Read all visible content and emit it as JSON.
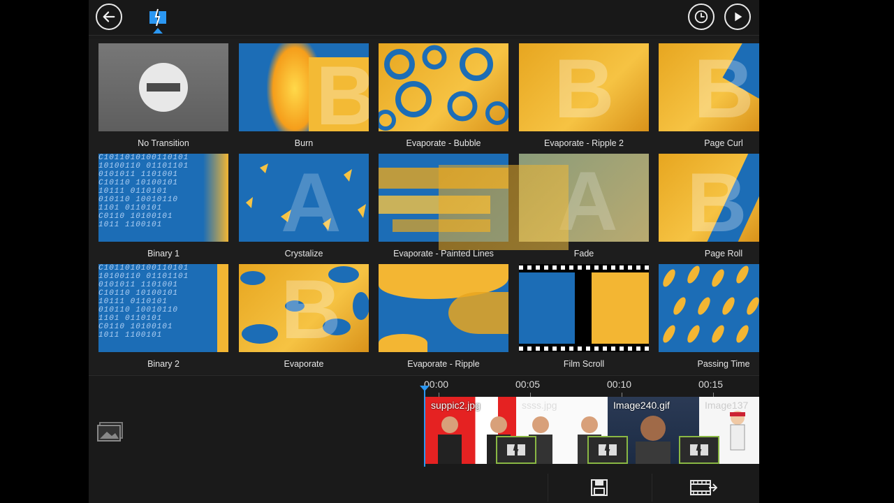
{
  "toolbar": {
    "back": "back",
    "fx_tab": "transition-effects",
    "history": "history",
    "play": "play"
  },
  "transitions": [
    {
      "label": "No Transition"
    },
    {
      "label": "Burn"
    },
    {
      "label": "Evaporate - Bubble"
    },
    {
      "label": "Evaporate - Ripple 2"
    },
    {
      "label": "Page Curl"
    },
    {
      "label": "Binary 1"
    },
    {
      "label": "Crystalize"
    },
    {
      "label": "Evaporate - Painted Lines"
    },
    {
      "label": "Fade"
    },
    {
      "label": "Page Roll"
    },
    {
      "label": "Binary 2"
    },
    {
      "label": "Evaporate"
    },
    {
      "label": "Evaporate - Ripple"
    },
    {
      "label": "Film Scroll"
    },
    {
      "label": "Passing Time"
    }
  ],
  "timeline": {
    "ruler": [
      "00:00",
      "00:05",
      "00:10",
      "00:15"
    ],
    "clips": [
      {
        "name": "suppic2.jpg"
      },
      {
        "name": "ssss.jpg"
      },
      {
        "name": "Image240.gif"
      },
      {
        "name": "Image137"
      }
    ]
  },
  "colors": {
    "accent_blue": "#2b97f2",
    "transition_border": "#8ab844",
    "thumb_blue": "#1c6db6",
    "thumb_gold": "#f6c343"
  }
}
